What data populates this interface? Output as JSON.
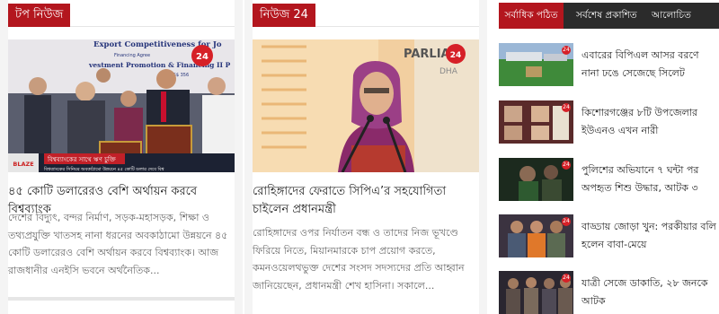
{
  "top_news": {
    "heading": "টপ নিউজ",
    "title": "৪৫ কোটি ডলারেরও বেশি অর্থায়ন করবে বিশ্বব্যাংক",
    "excerpt": "দেশের বিদ্যুৎ, বন্দর নির্মাণ, সড়ক-মহাসড়ক, শিক্ষা ও তথ্যপ্রযুক্তি খাতসহ নানা ধরনের অবকাঠামো উন্নয়নে ৪৫ কোটি ডলারেরও বেশি অর্থায়ন করবে বিশ্বব্যাংক। আজ রাজধানীর এনইসি ভবনে অর্থনৈতিক...",
    "photo": {
      "banner_text": "Export Competitiveness for Jo",
      "banner_line2": "vestment Promotion & Financing II P",
      "banner_line3": "Financing Agree",
      "banner_line4": "US$ 356",
      "logo": "BLAZE",
      "ticker_main": "বিশ্বব্যাংকের সাথে ঋণ চুক্তি",
      "ticker_sub": "বিশ্বব্যাংকের সিনিয়র অবকাঠামো উন্নয়নে ৪৫ কোটি ডলার দেবে বিশ্ব",
      "channel_badge": "24"
    }
  },
  "news24": {
    "heading": "নিউজ 24",
    "title": "রোহিঙ্গাদের ফেরাতে সিপিএ’র সহযোগিতা চাইলেন প্রধানমন্ত্রী",
    "excerpt": "রোহিঙ্গাদের ওপর নির্যাতন বন্ধ ও তাদের নিজ ভূখণ্ডে ফিরিয়ে নিতে, মিয়ানমারকে চাপ প্রয়োগ করতে, কমনওয়েলথভুক্ত দেশের সংসদ সদস্যদের প্রতি আহ্বান জানিয়েছেন, প্রধানমন্ত্রী শেখ হাসিনা। সকালে...",
    "photo": {
      "backdrop_text": "PARLIAM",
      "backdrop_sub": "DHA",
      "channel_badge": "24"
    }
  },
  "sidebar": {
    "tabs": [
      {
        "label": "সর্বাধিক পঠিত",
        "active": true
      },
      {
        "label": "সর্বশেষ প্রকাশিত",
        "active": false
      },
      {
        "label": "আলোচিত সংবাদ",
        "active": false
      }
    ],
    "items": [
      {
        "title": "এবারের বিপিএল আসর বরণে নানা ঢঙে সেজেছে সিলেট",
        "thumb": "stadium"
      },
      {
        "title": "কিশোরগঞ্জের ৮টি উপজেলার ইউএনও এখন নারী",
        "thumb": "portraits"
      },
      {
        "title": "পুলিশের অভিযানে ৭ ঘন্টা পর অপহৃত শিশু উদ্ধার, আটক ৩",
        "thumb": "child"
      },
      {
        "title": "বাড্ডায় জোড়া খুন: পরকীয়ার বলি হলেন বাবা-মেয়ে",
        "thumb": "police"
      },
      {
        "title": "যাত্রী সেজে ডাকাতি, ২৮ জনকে আটক",
        "thumb": "arrest"
      }
    ],
    "badge": "24"
  },
  "colors": {
    "accent": "#b3161e",
    "tab_bar": "#2b2b2b"
  }
}
